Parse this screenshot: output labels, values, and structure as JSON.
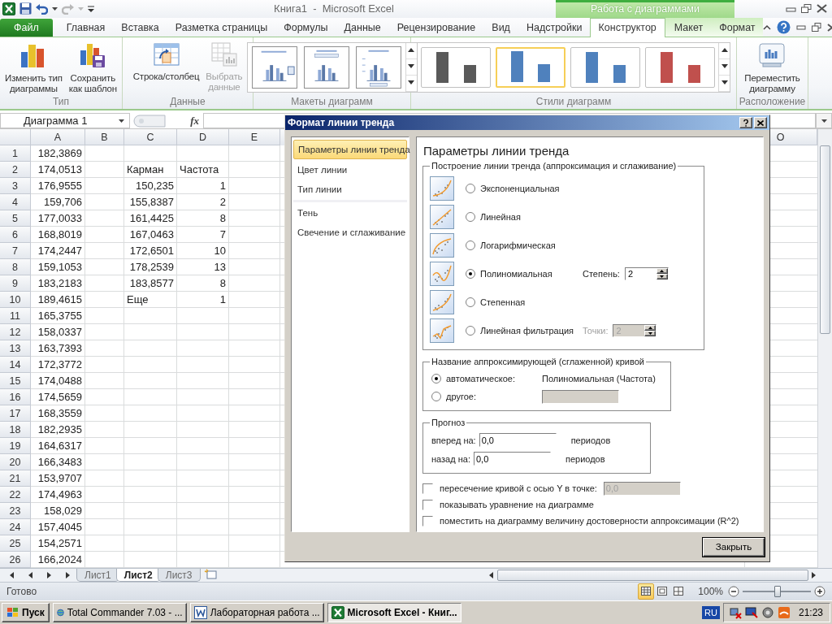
{
  "window": {
    "title": "Книга1  -  Microsoft Excel",
    "context_header": "Работа с диаграммами"
  },
  "ribbon": {
    "tabs": [
      {
        "label": "Файл",
        "kind": "file",
        "selected": false
      },
      {
        "label": "Главная",
        "kind": "main",
        "selected": false
      },
      {
        "label": "Вставка",
        "kind": "main",
        "selected": false
      },
      {
        "label": "Разметка страницы",
        "kind": "main",
        "selected": false
      },
      {
        "label": "Формулы",
        "kind": "main",
        "selected": false
      },
      {
        "label": "Данные",
        "kind": "main",
        "selected": false
      },
      {
        "label": "Рецензирование",
        "kind": "main",
        "selected": false
      },
      {
        "label": "Вид",
        "kind": "main",
        "selected": false
      },
      {
        "label": "Надстройки",
        "kind": "main",
        "selected": false
      },
      {
        "label": "Конструктор",
        "kind": "context",
        "selected": true
      },
      {
        "label": "Макет",
        "kind": "context",
        "selected": false
      },
      {
        "label": "Формат",
        "kind": "context",
        "selected": false
      }
    ],
    "groups": [
      {
        "label": "Тип",
        "kind": "buttons",
        "buttons": [
          {
            "lines": [
              "Изменить тип",
              "диаграммы"
            ],
            "kind": "change-type",
            "disabled": false
          },
          {
            "lines": [
              "Сохранить",
              "как шаблон"
            ],
            "kind": "save-template",
            "disabled": false
          }
        ]
      },
      {
        "label": "Данные",
        "kind": "buttons",
        "buttons": [
          {
            "lines": [
              "Строка/столбец"
            ],
            "kind": "switch-row",
            "disabled": false
          },
          {
            "lines": [
              "Выбрать",
              "данные"
            ],
            "kind": "select-data",
            "disabled": true
          }
        ]
      },
      {
        "label": "Макеты диаграмм",
        "kind": "layouts",
        "layouts": [
          {
            "kind": "legend-right"
          },
          {
            "kind": "title-top"
          },
          {
            "kind": "axis-titles"
          }
        ]
      },
      {
        "label": "Стили диаграмм",
        "kind": "styles",
        "styles": [
          {
            "color": "#5a5a5a",
            "selected": false
          },
          {
            "color": "#4f81bd",
            "selected": true
          },
          {
            "color": "#4f81bd",
            "selected": false
          },
          {
            "color": "#c0504d",
            "selected": false
          }
        ]
      },
      {
        "label": "Расположение",
        "kind": "buttons",
        "buttons": [
          {
            "lines": [
              "Переместить",
              "диаграмму"
            ],
            "kind": "move-chart",
            "disabled": false
          }
        ]
      }
    ]
  },
  "formula_bar": {
    "name_box": "Диаграмма 1",
    "function_label": "fx"
  },
  "sheet": {
    "columns": [
      "A",
      "B",
      "C",
      "D",
      "E",
      "O"
    ],
    "rows": [
      {
        "number": "1",
        "A": {
          "text": "182,3869",
          "kind": "number"
        }
      },
      {
        "number": "2",
        "A": {
          "text": "174,0513",
          "kind": "number"
        },
        "C": {
          "text": "Карман",
          "kind": "text"
        },
        "D": {
          "text": "Частота",
          "kind": "text"
        }
      },
      {
        "number": "3",
        "A": {
          "text": "176,9555",
          "kind": "number"
        },
        "C": {
          "text": "150,235",
          "kind": "number"
        },
        "D": {
          "text": "1",
          "kind": "number"
        }
      },
      {
        "number": "4",
        "A": {
          "text": "159,706",
          "kind": "number"
        },
        "C": {
          "text": "155,8387",
          "kind": "number"
        },
        "D": {
          "text": "2",
          "kind": "number"
        }
      },
      {
        "number": "5",
        "A": {
          "text": "177,0033",
          "kind": "number"
        },
        "C": {
          "text": "161,4425",
          "kind": "number"
        },
        "D": {
          "text": "8",
          "kind": "number"
        }
      },
      {
        "number": "6",
        "A": {
          "text": "168,8019",
          "kind": "number"
        },
        "C": {
          "text": "167,0463",
          "kind": "number"
        },
        "D": {
          "text": "7",
          "kind": "number"
        }
      },
      {
        "number": "7",
        "A": {
          "text": "174,2447",
          "kind": "number"
        },
        "C": {
          "text": "172,6501",
          "kind": "number"
        },
        "D": {
          "text": "10",
          "kind": "number"
        }
      },
      {
        "number": "8",
        "A": {
          "text": "159,1053",
          "kind": "number"
        },
        "C": {
          "text": "178,2539",
          "kind": "number"
        },
        "D": {
          "text": "13",
          "kind": "number"
        }
      },
      {
        "number": "9",
        "A": {
          "text": "183,2183",
          "kind": "number"
        },
        "C": {
          "text": "183,8577",
          "kind": "number"
        },
        "D": {
          "text": "8",
          "kind": "number"
        }
      },
      {
        "number": "10",
        "A": {
          "text": "189,4615",
          "kind": "number"
        },
        "C": {
          "text": "Еще",
          "kind": "text"
        },
        "D": {
          "text": "1",
          "kind": "number"
        }
      },
      {
        "number": "11",
        "A": {
          "text": "165,3755",
          "kind": "number"
        }
      },
      {
        "number": "12",
        "A": {
          "text": "158,0337",
          "kind": "number"
        }
      },
      {
        "number": "13",
        "A": {
          "text": "163,7393",
          "kind": "number"
        }
      },
      {
        "number": "14",
        "A": {
          "text": "172,3772",
          "kind": "number"
        }
      },
      {
        "number": "15",
        "A": {
          "text": "174,0488",
          "kind": "number"
        }
      },
      {
        "number": "16",
        "A": {
          "text": "174,5659",
          "kind": "number"
        }
      },
      {
        "number": "17",
        "A": {
          "text": "168,3559",
          "kind": "number"
        }
      },
      {
        "number": "18",
        "A": {
          "text": "182,2935",
          "kind": "number"
        }
      },
      {
        "number": "19",
        "A": {
          "text": "164,6317",
          "kind": "number"
        }
      },
      {
        "number": "20",
        "A": {
          "text": "166,3483",
          "kind": "number"
        }
      },
      {
        "number": "21",
        "A": {
          "text": "153,9707",
          "kind": "number"
        }
      },
      {
        "number": "22",
        "A": {
          "text": "174,4963",
          "kind": "number"
        }
      },
      {
        "number": "23",
        "A": {
          "text": "158,029",
          "kind": "number"
        }
      },
      {
        "number": "24",
        "A": {
          "text": "157,4045",
          "kind": "number"
        }
      },
      {
        "number": "25",
        "A": {
          "text": "154,2571",
          "kind": "number"
        }
      },
      {
        "number": "26",
        "A": {
          "text": "166,2024",
          "kind": "number"
        }
      }
    ]
  },
  "sheet_tabs": [
    {
      "label": "Лист1",
      "selected": false
    },
    {
      "label": "Лист2",
      "selected": true
    },
    {
      "label": "Лист3",
      "selected": false
    }
  ],
  "status_bar": {
    "text": "Готово",
    "views": [
      {
        "kind": "normal",
        "selected": true
      },
      {
        "kind": "page-layout",
        "selected": false
      },
      {
        "kind": "page-break",
        "selected": false
      }
    ],
    "zoom": "100%",
    "zoom_slider": {
      "level": 0.5
    }
  },
  "taskbar": {
    "start": "Пуск",
    "tasks": [
      {
        "label": "Total Commander 7.03 - ...",
        "kind": "commander",
        "selected": false
      },
      {
        "label": "Лабораторная работа ...",
        "kind": "word",
        "selected": false
      },
      {
        "label": "Microsoft Excel - Книг...",
        "kind": "excel",
        "selected": true
      }
    ],
    "language": "RU",
    "clock": "21:23"
  },
  "dialog": {
    "title": "Формат линии тренда",
    "nav": [
      {
        "label": "Параметры линии тренда",
        "selected": true
      },
      {
        "label": "Цвет линии",
        "selected": false
      },
      {
        "label": "Тип линии",
        "selected": false
      },
      {
        "label": "Тень",
        "selected": false,
        "separator_before": true
      },
      {
        "label": "Свечение и сглаживание",
        "selected": false
      }
    ],
    "heading": "Параметры линии тренда",
    "trend_type": {
      "legend": "Построение линии тренда (аппроксимация и сглаживание)",
      "options": [
        {
          "kind": "exponential",
          "label": "Экспоненциальная",
          "selected": false
        },
        {
          "kind": "linear",
          "label": "Линейная",
          "selected": false
        },
        {
          "kind": "logarithmic",
          "label": "Логарифмическая",
          "selected": false
        },
        {
          "kind": "polynomial",
          "label": "Полиномиальная",
          "selected": true,
          "param": {
            "label": "Степень:",
            "value": "2",
            "disabled": false
          }
        },
        {
          "kind": "power",
          "label": "Степенная",
          "selected": false
        },
        {
          "kind": "moving-average",
          "label": "Линейная фильтрация",
          "selected": false,
          "param": {
            "label": "Точки:",
            "value": "2",
            "disabled": true
          }
        }
      ]
    },
    "name": {
      "legend": "Название аппроксимирующей (сглаженной) кривой",
      "options": [
        {
          "kind": "auto",
          "label": "автоматическое:",
          "selected": true,
          "value": "Полиномиальная (Частота)"
        },
        {
          "kind": "custom",
          "label": "другое:",
          "selected": false,
          "field_disabled": true
        }
      ]
    },
    "forecast": {
      "legend": "Прогноз",
      "rows": [
        {
          "label": "вперед на:",
          "value": "0,0",
          "unit": "периодов"
        },
        {
          "label": "назад на:",
          "value": "0,0",
          "unit": "периодов"
        }
      ]
    },
    "checks": [
      {
        "label": "пересечение кривой с осью Y в точке:",
        "checked": false,
        "field": {
          "value": "0,0",
          "disabled": true
        }
      },
      {
        "label": "показывать уравнение на диаграмме",
        "checked": false
      },
      {
        "label": "поместить на диаграмму величину достоверности аппроксимации (R^2)",
        "checked": false
      }
    ],
    "close_button": "Закрыть"
  }
}
